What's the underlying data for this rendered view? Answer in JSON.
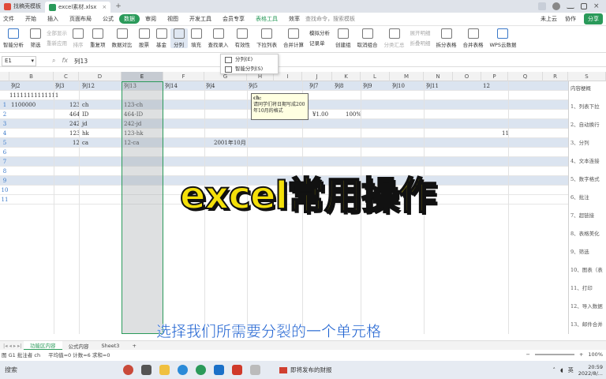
{
  "tabs": [
    {
      "label": "找稿壳模板"
    },
    {
      "label": "excel素材.xlsx"
    }
  ],
  "menu": {
    "file": "文件",
    "items": [
      "开始",
      "插入",
      "页面布局",
      "公式",
      "数据",
      "审阅",
      "视图",
      "开发工具",
      "会员专享"
    ],
    "active": "数据",
    "table_tools": "表格工具",
    "efficiency": "效率",
    "search": "查找命令，搜索模板",
    "cloud": "未上云",
    "collab": "协作",
    "share": "分享"
  },
  "ribbon": {
    "items": [
      "智能分析",
      "筛选",
      "排序",
      "重复项",
      "数据对比",
      "股票",
      "基金",
      "分列",
      "填充",
      "查找录入",
      "有效性",
      "下拉列表",
      "合并计算",
      "记录单",
      "创建组",
      "取消组合",
      "分类汇总",
      "拆分表格",
      "合并表格",
      "WPS云数据"
    ],
    "dim_stack_1": [
      "全部显示",
      "重新应用"
    ],
    "dim_stack_2": [
      "展开明细",
      "折叠明细"
    ],
    "sim_analysis": "模拟分析"
  },
  "dropdown": {
    "items": [
      "分列(E)",
      "智能分列(S)"
    ]
  },
  "formula_bar": {
    "namebox": "E1",
    "fx": "fx",
    "content": "列13"
  },
  "columns": [
    "B",
    "C",
    "D",
    "E",
    "F",
    "G",
    "H",
    "I",
    "J",
    "K",
    "L",
    "M",
    "N",
    "O",
    "P",
    "Q",
    "R",
    "S"
  ],
  "header_row": [
    "列2",
    "列3",
    "列12",
    "列13",
    "列14",
    "列4",
    "列5",
    "列7",
    "列8",
    "列9",
    "列10",
    "列11",
    "12"
  ],
  "rows": [
    {
      "num": "",
      "b": "11111111111111",
      "c": "",
      "d": "",
      "e": "",
      "g": ""
    },
    {
      "num": "1",
      "b": "1100000",
      "c": "123",
      "d": "ch",
      "e": "123-ch",
      "g": ""
    },
    {
      "num": "2",
      "b": "",
      "c": "464",
      "d": "ID",
      "e": "464-ID",
      "g": ""
    },
    {
      "num": "3",
      "b": "",
      "c": "242",
      "d": "jd",
      "e": "242-jd",
      "g": ""
    },
    {
      "num": "4",
      "b": "",
      "c": "123",
      "d": "hk",
      "e": "123-hk",
      "g": ""
    },
    {
      "num": "5",
      "b": "",
      "c": "12",
      "d": "ca",
      "e": "12-ca",
      "g": "2001年10月"
    },
    {
      "num": "6"
    },
    {
      "num": "7"
    },
    {
      "num": "8"
    },
    {
      "num": "9"
    },
    {
      "num": "10"
    },
    {
      "num": "11"
    }
  ],
  "extra_cells": {
    "j2": "¥1.00",
    "k2": "100%",
    "q5": "11"
  },
  "comment": {
    "author": "ch:",
    "text": "请同学们将日期写成200年10月的格式"
  },
  "right_panel": {
    "title": "内容梗概",
    "items": [
      "1、列表下拉",
      "2、自动换行",
      "3、分列",
      "4、文本连接",
      "5、数字格式",
      "6、批注",
      "7、超链接",
      "8、表格美化",
      "9、筛选",
      "10、图表（表",
      "11、打印",
      "12、导入数据",
      "13、邮件合并"
    ]
  },
  "overlay": {
    "title": "excel常用操作",
    "subtitle": "选择我们所需要分裂的一个单元格"
  },
  "sheets": [
    "功能区内容",
    "公式内容",
    "Sheet3"
  ],
  "active_sheet": "功能区内容",
  "status": {
    "left": "图 G1 批注者 ch",
    "stats": "平均值=0  计数=6  求和=0",
    "zoom": "100%"
  },
  "taskbar": {
    "search": "搜索",
    "news": "即将发布的财报",
    "lang": "英",
    "time": "20:59",
    "date": "2022/8/..."
  }
}
